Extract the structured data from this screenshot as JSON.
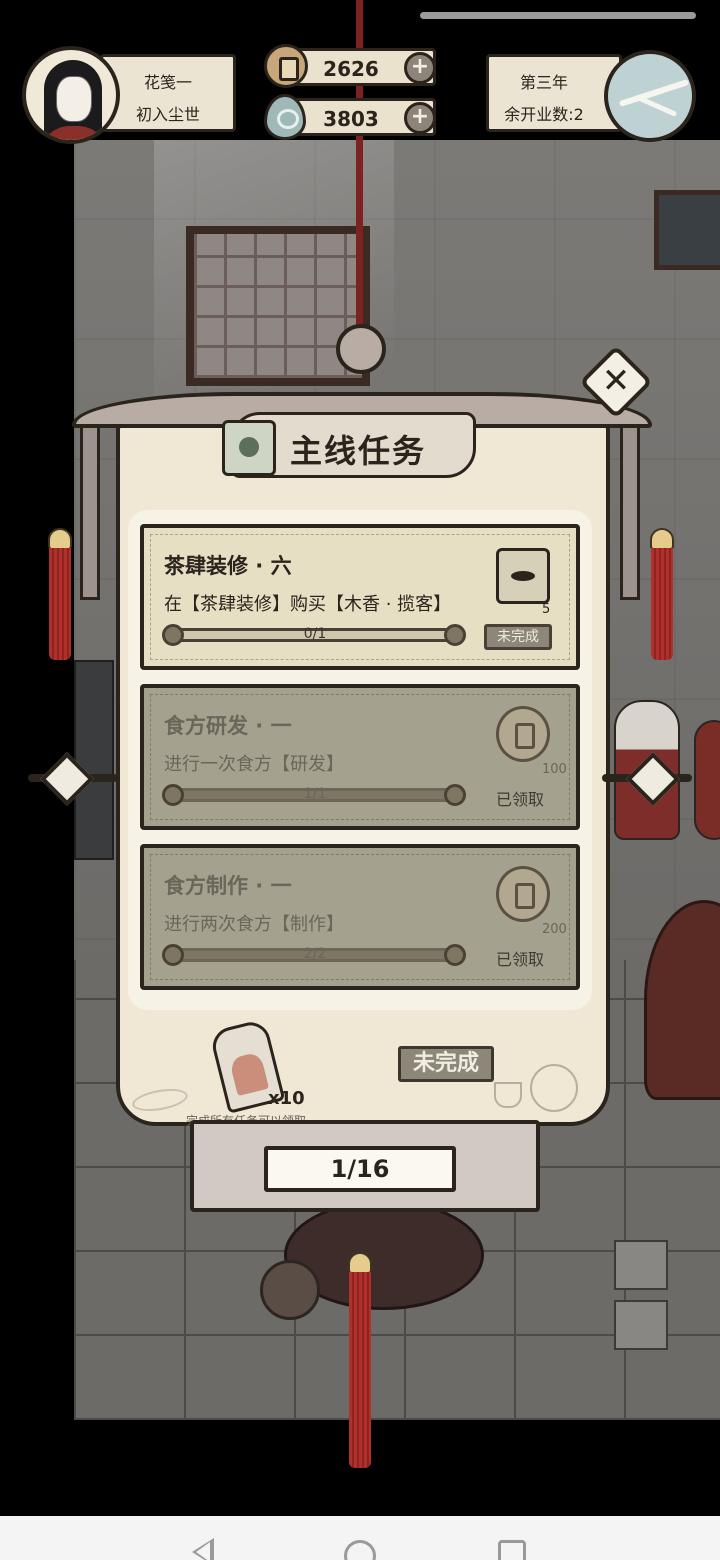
{
  "player": {
    "name": "花笺一",
    "title": "初入尘世"
  },
  "currency": {
    "coins": "2626",
    "jade": "3803"
  },
  "season": {
    "year": "第三年",
    "remaining": "余开业数:2"
  },
  "panel": {
    "title": "主线任务"
  },
  "quests": [
    {
      "title": "茶肆装修 · 六",
      "desc": "在【茶肆装修】购买【木香 · 揽客】",
      "progress": "0/1",
      "progress_value": 0,
      "reward_count": "5",
      "reward_icon": "decor-book-icon",
      "status": "未完成"
    },
    {
      "title": "食方研发 · 一",
      "desc": "进行一次食方【研发】",
      "progress": "1/1",
      "progress_value": 1,
      "reward_count": "100",
      "reward_icon": "copper-coin-icon",
      "status": "已领取"
    },
    {
      "title": "食方制作 · 一",
      "desc": "进行两次食方【制作】",
      "progress": "2/2",
      "progress_value": 1,
      "reward_count": "200",
      "reward_icon": "copper-coin-icon",
      "status": "已领取"
    }
  ],
  "final_reward": {
    "count": "x10",
    "hint": "完成所有任务可以领取",
    "status": "未完成"
  },
  "pagination": {
    "page": "1/16"
  },
  "colors": {
    "paper": "#f0e8d4",
    "ink": "#2a241d",
    "tassel_red": "#b0302b"
  }
}
